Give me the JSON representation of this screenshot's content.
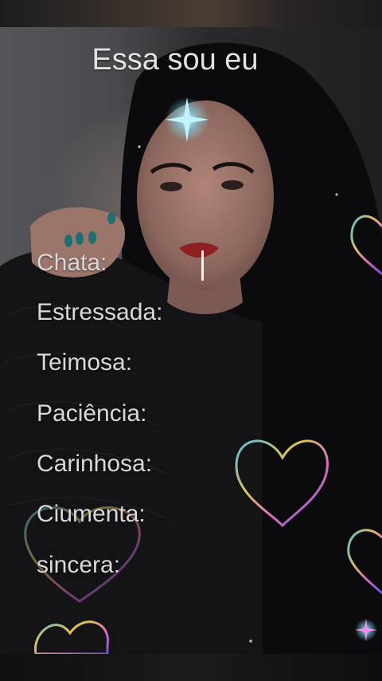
{
  "title": "Essa sou eu",
  "fields": [
    {
      "label": "Chata:"
    },
    {
      "label": "Estressada:"
    },
    {
      "label": "Teimosa:"
    },
    {
      "label": "Paciência:"
    },
    {
      "label": "Carinhosa:"
    },
    {
      "label": "Ciumenta:"
    },
    {
      "label": "sincera:"
    }
  ],
  "icons": {
    "sparkle": "sparkle-icon",
    "heart": "heart-icon"
  },
  "colors": {
    "text": "#d9d9dc",
    "cursor": "#f2f2f2",
    "hair": "#0b0b0d"
  }
}
